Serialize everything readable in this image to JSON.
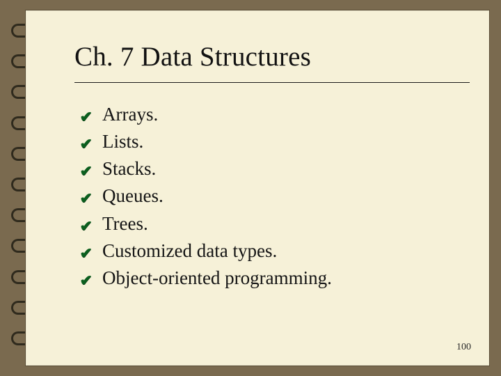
{
  "title": "Ch. 7 Data Structures",
  "bullets": [
    "Arrays.",
    "Lists.",
    "Stacks.",
    "Queues.",
    "Trees.",
    "Customized data types.",
    "Object-oriented programming."
  ],
  "page_number": "100"
}
